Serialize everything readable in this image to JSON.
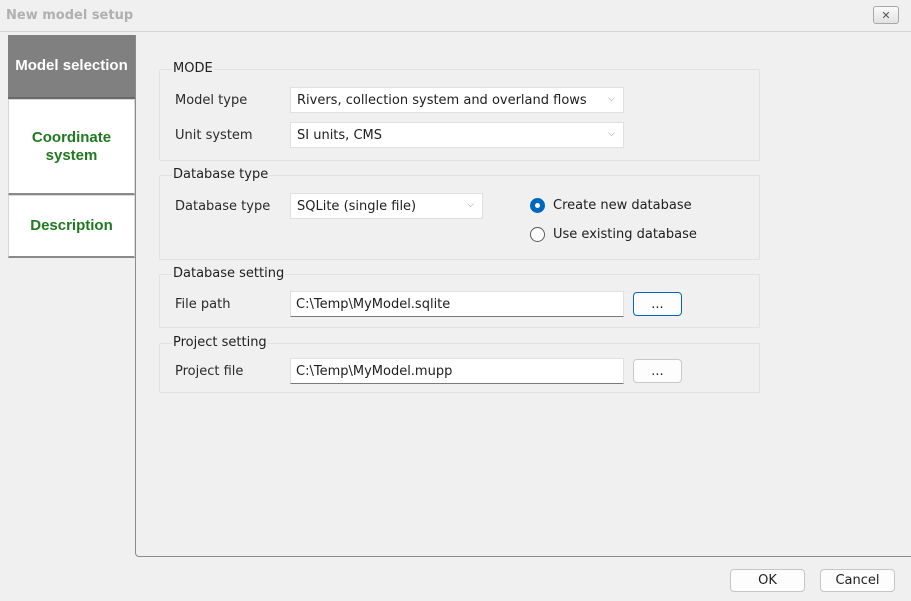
{
  "window": {
    "title": "New model setup",
    "close_icon": "close-icon"
  },
  "sidebar": {
    "tabs": [
      {
        "label": "Model selection",
        "active": true
      },
      {
        "label": "Coordinate system",
        "active": false
      },
      {
        "label": "Description",
        "active": false
      }
    ]
  },
  "mode": {
    "title": "MODE",
    "model_type_label": "Model type",
    "model_type_value": "Rivers, collection system and overland flows",
    "unit_system_label": "Unit system",
    "unit_system_value": "SI units, CMS"
  },
  "database_type": {
    "title": "Database type",
    "label": "Database type",
    "value": "SQLite (single file)",
    "option_create": "Create new database",
    "option_existing": "Use existing database",
    "selected": "create"
  },
  "database_setting": {
    "title": "Database setting",
    "label": "File path",
    "value": "C:\\Temp\\MyModel.sqlite",
    "browse_label": "..."
  },
  "project_setting": {
    "title": "Project setting",
    "label": "Project file",
    "value": "C:\\Temp\\MyModel.mupp",
    "browse_label": "..."
  },
  "footer": {
    "ok_label": "OK",
    "cancel_label": "Cancel"
  },
  "colors": {
    "accent": "#0067c0",
    "tab_text": "#1f7a1f",
    "active_tab_bg": "#808080"
  }
}
